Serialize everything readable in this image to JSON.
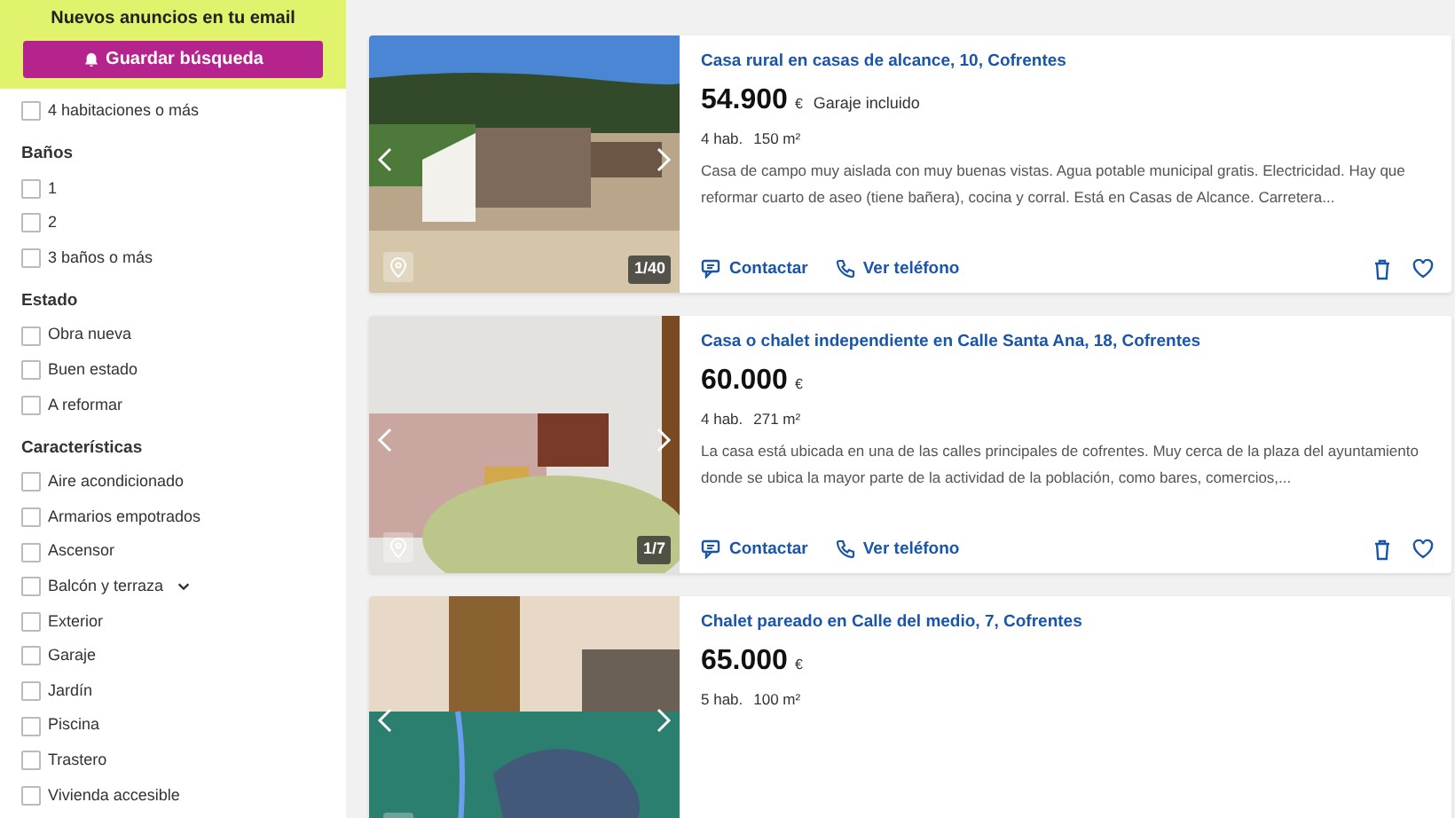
{
  "alert_panel": {
    "title": "Nuevos anuncios en tu email",
    "button": "Guardar búsqueda"
  },
  "filters": [
    {
      "items": [
        {
          "label": "4 habitaciones o más",
          "checked": false
        }
      ]
    },
    {
      "title": "Baños",
      "items": [
        {
          "label": "1",
          "checked": false
        },
        {
          "label": "2",
          "checked": false
        },
        {
          "label": "3 baños o más",
          "checked": false
        }
      ]
    },
    {
      "title": "Estado",
      "items": [
        {
          "label": "Obra nueva",
          "checked": false
        },
        {
          "label": "Buen estado",
          "checked": false
        },
        {
          "label": "A reformar",
          "checked": false
        }
      ]
    },
    {
      "title": "Características",
      "items": [
        {
          "label": "Aire acondicionado",
          "checked": false
        },
        {
          "label": "Armarios empotrados",
          "checked": false
        },
        {
          "label": "Ascensor",
          "checked": false
        },
        {
          "label": "Balcón y terraza",
          "checked": false,
          "expanded": false
        },
        {
          "label": "Exterior",
          "checked": false
        },
        {
          "label": "Garaje",
          "checked": false
        },
        {
          "label": "Jardín",
          "checked": false
        },
        {
          "label": "Piscina",
          "checked": false
        },
        {
          "label": "Trastero",
          "checked": false
        },
        {
          "label": "Vivienda accesible",
          "checked": false
        }
      ]
    }
  ],
  "listings": [
    {
      "title": "Casa rural en casas de alcance, 10, Cofrentes",
      "price": "54.900",
      "currency": "€",
      "extra": "Garaje incluido",
      "rooms": "4 hab.",
      "area": "150 m²",
      "description": "Casa de campo muy aislada con muy buenas vistas. Agua potable municipal gratis. Electricidad. Hay que reformar cuarto de aseo (tiene bañera), cocina y corral. Está en Casas de Alcance. Carretera...",
      "photo_count": "1/40",
      "kind": "landscape",
      "contact": "Contactar",
      "phone": "Ver teléfono"
    },
    {
      "title": "Casa o chalet independiente en Calle Santa Ana, 18, Cofrentes",
      "price": "60.000",
      "currency": "€",
      "rooms": "4 hab.",
      "area": "271 m²",
      "description": "La casa está ubicada en una de las calles principales de cofrentes. Muy cerca de la plaza del ayuntamiento donde se ubica la mayor parte de la actividad de la población, como bares, comercios,...",
      "photo_count": "1/7",
      "kind": "interior",
      "contact": "Contactar",
      "phone": "Ver teléfono"
    },
    {
      "title": "Chalet pareado en Calle del medio, 7, Cofrentes",
      "price": "65.000",
      "currency": "€",
      "rooms": "5 hab.",
      "area": "100 m²",
      "kind": "street_map"
    }
  ]
}
